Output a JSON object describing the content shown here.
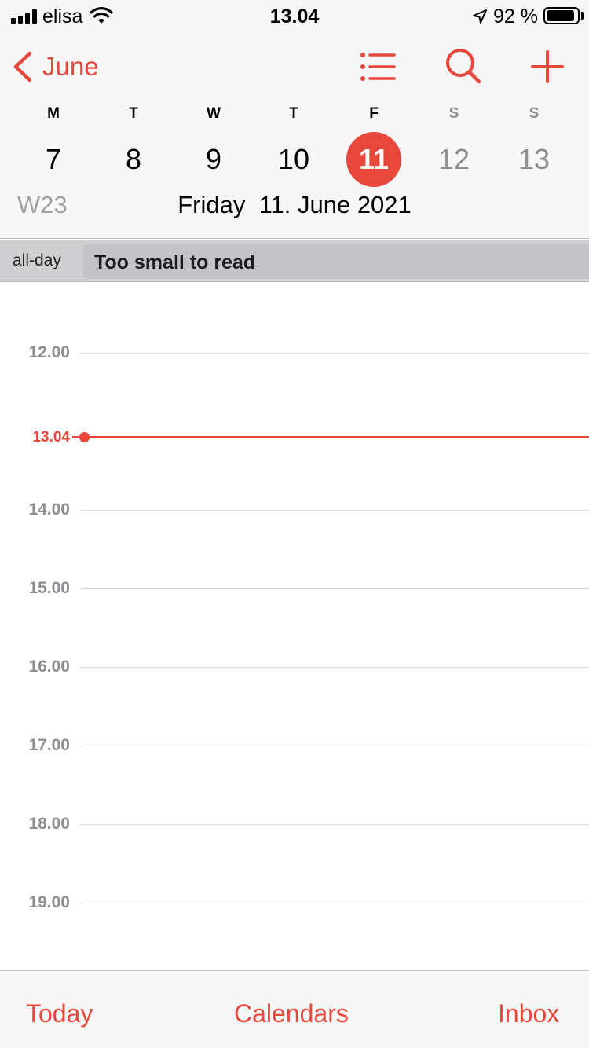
{
  "status_bar": {
    "carrier": "elisa",
    "time": "13.04",
    "battery": "92 %",
    "battery_level": 0.92
  },
  "nav": {
    "back_label": "June",
    "icons": [
      "list-icon",
      "search-icon",
      "add-icon"
    ]
  },
  "week": {
    "weekdays": [
      "M",
      "T",
      "W",
      "T",
      "F",
      "S",
      "S"
    ],
    "days": [
      "7",
      "8",
      "9",
      "10",
      "11",
      "12",
      "13"
    ],
    "selected_index": 4,
    "week_label": "W23",
    "full_date": "Friday  11. June 2021"
  },
  "all_day": {
    "label": "all-day",
    "event_title": "Too small to read"
  },
  "timeline": {
    "hours": [
      "12.00",
      "14.00",
      "15.00",
      "16.00",
      "17.00",
      "18.00",
      "19.00"
    ],
    "current_time": "13.04"
  },
  "tab_bar": {
    "today": "Today",
    "calendars": "Calendars",
    "inbox": "Inbox"
  },
  "colors": {
    "accent": "#e8473c",
    "inactive": "#8e8e93"
  }
}
